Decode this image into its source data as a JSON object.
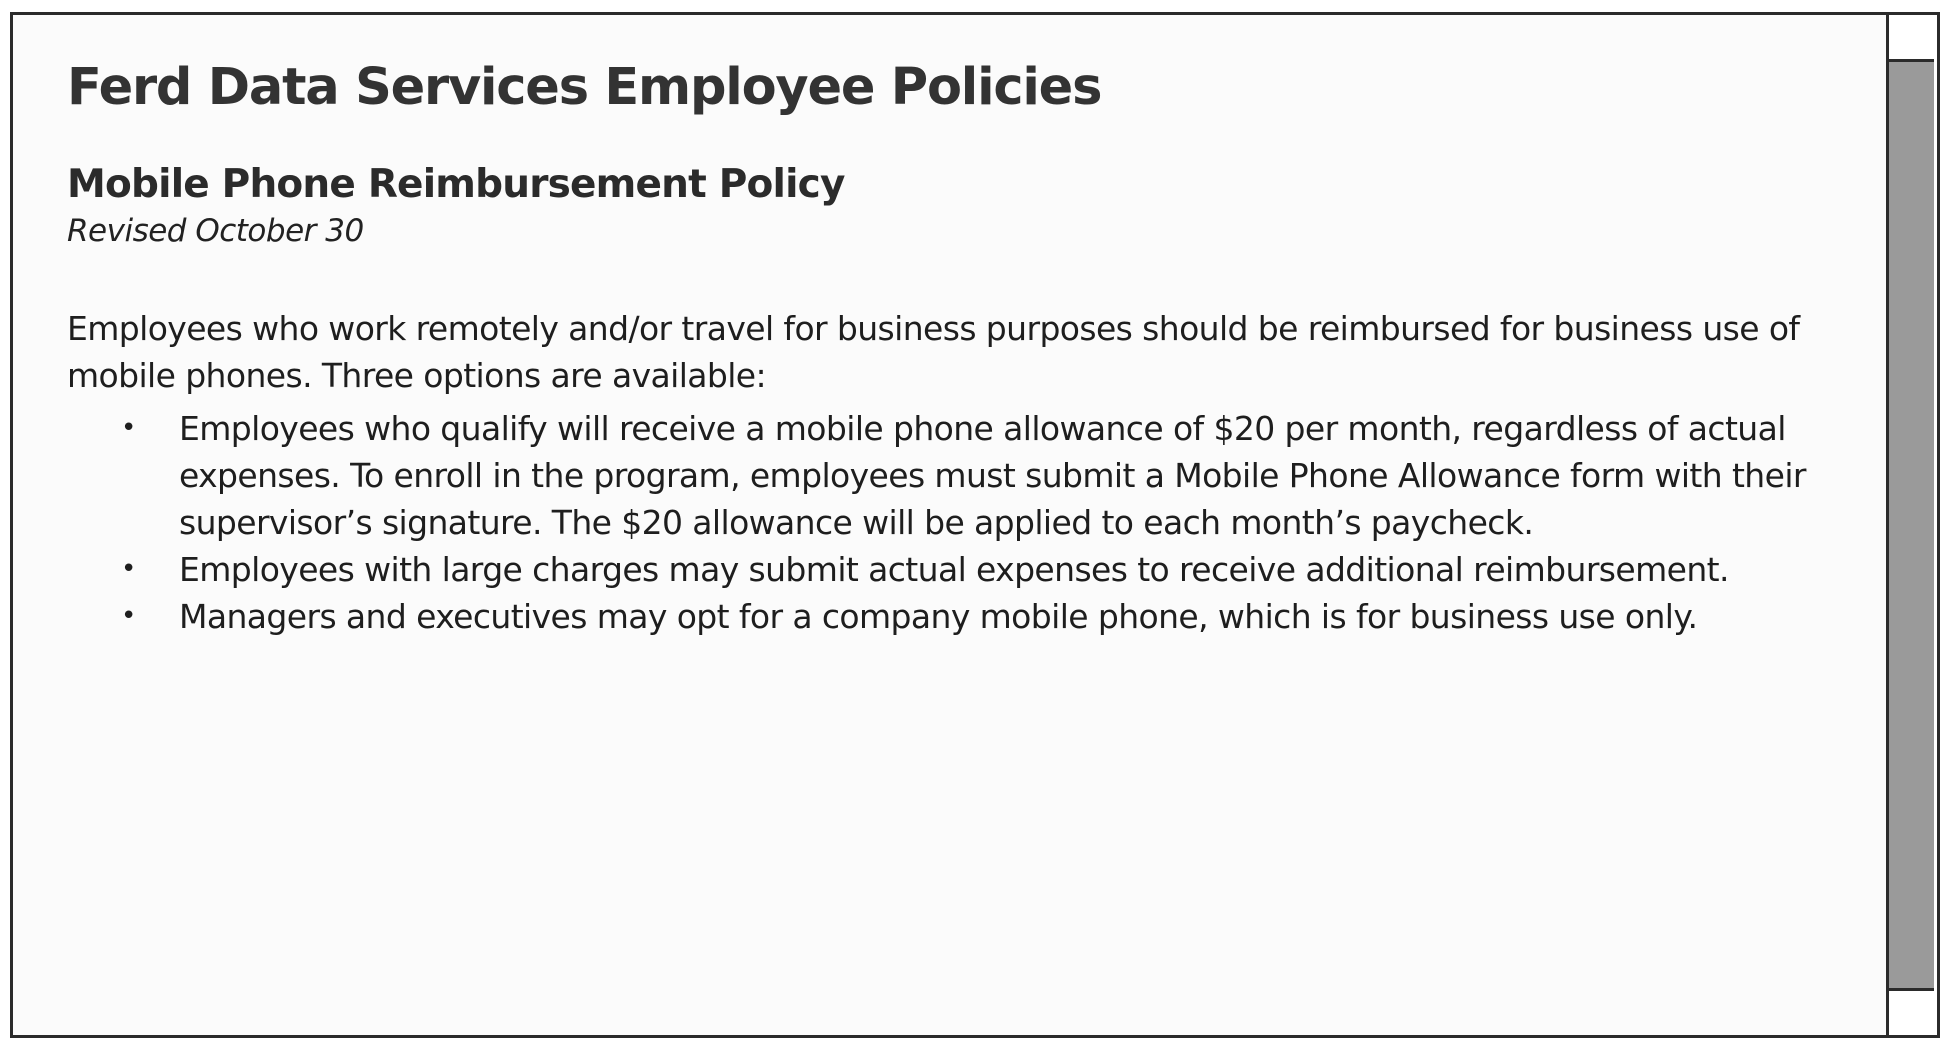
{
  "document": {
    "title": "Ferd Data Services Employee Policies",
    "section_title": "Mobile Phone Reimbursement Policy",
    "revised": "Revised October 30",
    "intro": "Employees who work remotely and/or travel for business purposes should be reimbursed for business use of mobile phones. Three options are available:",
    "bullets": [
      {
        "symbol": "•",
        "text": "Employees who qualify will receive a mobile phone allowance of $20 per month, regardless of actual expenses. To enroll in the program, employees must submit a Mobile Phone Allowance form with their supervisor’s signature. The $20 allowance will be applied to each month’s paycheck."
      },
      {
        "symbol": "•",
        "text": "Employees with large charges may submit actual expenses to receive additional reimbursement."
      },
      {
        "symbol": "•",
        "text": "Managers and executives may opt for a company mobile phone, which is for business use only."
      }
    ]
  },
  "scrollbar": {
    "position": 0.0
  }
}
